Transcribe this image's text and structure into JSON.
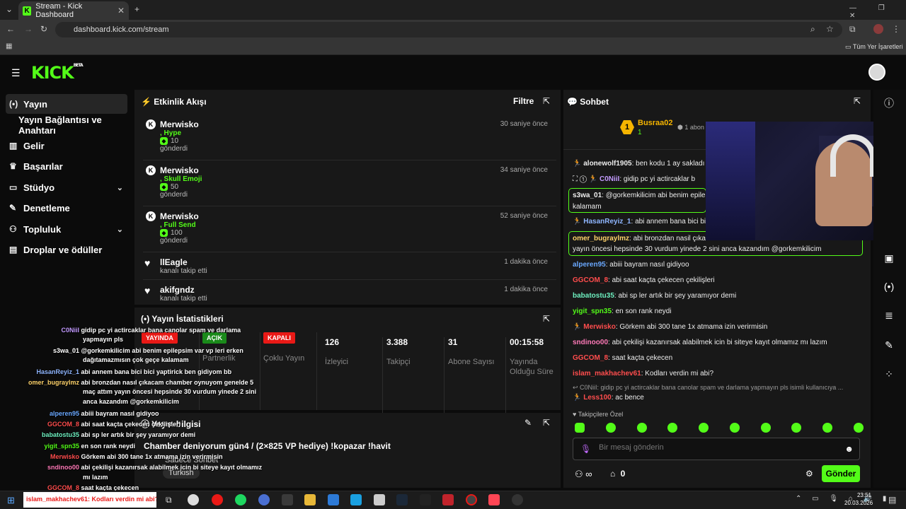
{
  "browser": {
    "tab_title": "Stream - Kick Dashboard",
    "url": "dashboard.kick.com/stream",
    "bookmarks_label": "Tüm Yer İşaretleri"
  },
  "brand": {
    "logo": "KICK",
    "beta": "BETA",
    "accent": "#53fc18"
  },
  "sidebar": {
    "items": [
      {
        "label": "Yayın",
        "icon": "broadcast-icon"
      },
      {
        "label": "Yayın Bağlantısı ve Anahtarı"
      },
      {
        "label": "Gelir",
        "icon": "chart-icon"
      },
      {
        "label": "Başarılar",
        "icon": "trophy-icon"
      },
      {
        "label": "Stüdyo",
        "icon": "studio-icon"
      },
      {
        "label": "Denetleme",
        "icon": "wrench-icon"
      },
      {
        "label": "Topluluk",
        "icon": "people-icon"
      },
      {
        "label": "Droplar ve ödüller",
        "icon": "gift-icon"
      }
    ]
  },
  "activity": {
    "title": "Etkinlik Akışı",
    "filter": "Filtre",
    "events": [
      {
        "name": "Merwisko",
        "sub": ", Hype",
        "amount": "10",
        "verb": "gönderdi",
        "time": "30 saniye önce"
      },
      {
        "name": "Merwisko",
        "sub": ", Skull Emoji",
        "amount": "50",
        "verb": "gönderdi",
        "time": "34 saniye önce"
      },
      {
        "name": "Merwisko",
        "sub": ", Full Send",
        "amount": "100",
        "verb": "gönderdi",
        "time": "52 saniye önce"
      },
      {
        "name": "llEagle",
        "verb": "kanalı takip etti",
        "time": "1 dakika önce"
      },
      {
        "name": "akifgndz",
        "verb": "kanalı takip etti",
        "time": "1 dakika önce"
      }
    ]
  },
  "stats": {
    "title": "Yayın İstatistikleri",
    "badges": [
      {
        "badge": "YAYINDA",
        "label": ""
      },
      {
        "badge": "AÇIK",
        "label": "Partnerlik"
      },
      {
        "badge": "KAPALI",
        "label": "Çoklu Yayın"
      }
    ],
    "items": [
      {
        "value": "126",
        "label": "İzleyici"
      },
      {
        "value": "3.388",
        "label": "Takipçi"
      },
      {
        "value": "31",
        "label": "Abone Sayısı"
      },
      {
        "value": "00:15:58",
        "label": "Yayında Olduğu Süre"
      }
    ]
  },
  "info": {
    "title": "Yayın bilgisi",
    "stream_title": "Chamber deniyorum gün4 / (2×825 VP hediye) !kopazar !havit",
    "mode": "Sadece Sohbet",
    "language": "Turkish"
  },
  "chat": {
    "title": "Sohbet",
    "pinned_user": "Busraa02",
    "pinned_count": "1",
    "pinned_sub": "1 abon",
    "messages": [
      {
        "user": "alonewolf1905",
        "text": "ben kodu 1 ay sakladı",
        "color": "#ffffff"
      },
      {
        "user": "C0NiiI",
        "text": "gidip pc yi actircaklar b",
        "color": "#c39bff"
      },
      {
        "user": "s3wa_01",
        "text": "@gorkemkilicim abi benim epile",
        "text2": "kalamam",
        "color": "#ffffff"
      },
      {
        "user": "HasanReyiz_1",
        "text": "abi annem bana bici bic",
        "color": "#8fb6ff"
      },
      {
        "user": "omer_bugraylmz",
        "text": "abi bronzdan nasil çıka",
        "text2": "yayın öncesi hepsinde 30 vurdum yinede 2 sini anca kazandım @gorkemkilicim",
        "color": "#ffd36b"
      },
      {
        "user": "alperen95",
        "text": "abiii bayram nasıl gidiyoo",
        "color": "#6aa8ff"
      },
      {
        "user": "GGCOM_8",
        "text": "abi saat kaçta çekecen çekilişleri",
        "color": "#ff4d4d"
      },
      {
        "user": "babatostu35",
        "text": "abi sp ler artık bir şey yaramıyor demi",
        "color": "#6ef0c0"
      },
      {
        "user": "yigit_spn35",
        "text": "en son rank neydi",
        "color": "#53fc18"
      },
      {
        "user": "Merwisko",
        "text": "Görkem abi 300 tane 1x atmama izin verirmisin",
        "color": "#ff4d4d"
      },
      {
        "user": "sndinoo00",
        "text": "abi çekilişi kazanırsak alabilmek icin bi siteye kayıt olmamız mı lazım",
        "color": "#ff7ab8"
      },
      {
        "user": "GGCOM_8",
        "text": "saat kaçta çekecen",
        "color": "#ff4d4d"
      },
      {
        "user": "islam_makhachev61",
        "text": "Kodları verdin mi abi?",
        "color": "#ff4d4d"
      }
    ],
    "reply_preview": "C0NiiI: gidip pc yi actircaklar bana canolar spam ve darlama yapmayın pls isimli kullanıcıya ...",
    "last": {
      "user": "Less100",
      "text": "ac bence",
      "color": "#ff4d4d"
    },
    "followers_only": "Takipçilere Özel",
    "placeholder": "Bir mesaj gönderin",
    "infinity": "∞",
    "count": "0",
    "send": "Gönder"
  },
  "overlay": {
    "lines": [
      {
        "user": "C0NiiI",
        "text": "gidip pc yi actircaklar bana canolar spam ve darlama",
        "color": "#c39bff"
      },
      {
        "user": "",
        "text": "yapmayın pls",
        "color": "#fff"
      },
      {
        "user": "s3wa_01",
        "text": "@gorkemkilicim abi benim epilepsim var vp leri erken",
        "color": "#ffffff"
      },
      {
        "user": "",
        "text": "dağıtamazmısın çok geçe kalamam",
        "color": "#fff"
      },
      {
        "user": "HasanReyiz_1",
        "text": "abi annem bana bici bici yaptirick ben gidiyom bb",
        "color": "#8fb6ff"
      },
      {
        "user": "omer_bugraylmz",
        "text": "abi bronzdan nasıl çıkacam chamber oynuyom genelde 5",
        "color": "#ffd36b"
      },
      {
        "user": "",
        "text": "maç attım yayın öncesi hepsinde 30 vurdum yinede 2 sini",
        "color": "#fff"
      },
      {
        "user": "",
        "text": "anca kazandım @gorkemkilicim",
        "color": "#fff"
      },
      {
        "user": "alperen95",
        "text": "abiii bayram nasıl gidiyoo",
        "color": "#6aa8ff"
      },
      {
        "user": "GGCOM_8",
        "text": "abi saat kaçta çekecen çekilişleri",
        "color": "#ff4d4d"
      },
      {
        "user": "babatostu35",
        "text": "abi sp ler artık bir şey yaramıyor demi",
        "color": "#6ef0c0"
      },
      {
        "user": "yigit_spn35",
        "text": "en son rank neydi",
        "color": "#53fc18"
      },
      {
        "user": "Merwisko",
        "text": "Görkem abi 300 tane 1x atmama izin verirmisin",
        "color": "#ff4d4d"
      },
      {
        "user": "sndinoo00",
        "text": "abi çekilişi kazanırsak alabilmek icin bi siteye kayıt olmamız",
        "color": "#ff7ab8"
      },
      {
        "user": "",
        "text": "mı lazım",
        "color": "#fff"
      },
      {
        "user": "GGCOM_8",
        "text": "saat kaçta çekecen",
        "color": "#ff4d4d"
      }
    ],
    "popup": "islam_makhachev61: Kodları verdin mi abi?"
  },
  "taskbar": {
    "time": "23:51",
    "date": "20.03.2026"
  }
}
